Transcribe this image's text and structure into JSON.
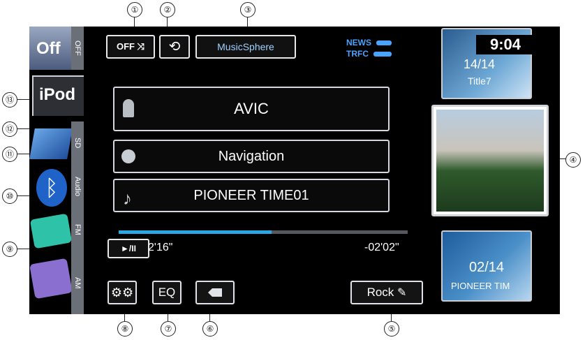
{
  "callouts": [
    "①",
    "②",
    "③",
    "④",
    "⑤",
    "⑥",
    "⑦",
    "⑧",
    "⑨",
    "⑩",
    "⑪",
    "⑫",
    "⑬"
  ],
  "sources": [
    {
      "label": "OFF",
      "button": "Off"
    },
    {
      "label": "iPod",
      "button": "iPod"
    },
    {
      "label": "SD",
      "button": ""
    },
    {
      "label": "Audio",
      "button": ""
    },
    {
      "label": "FM",
      "button": ""
    },
    {
      "label": "AM",
      "button": ""
    }
  ],
  "top_bar": {
    "shuffle": "OFF ⤨",
    "repeat": "⟲",
    "musicsphere_logo": "MusicSphere",
    "news": "NEWS",
    "trfc": "TRFC"
  },
  "clock": "9:04",
  "next_track": {
    "index": "14/14",
    "title": "Title7"
  },
  "prev_track": {
    "index": "02/14",
    "title": "PIONEER TIM"
  },
  "info": {
    "artist": "AVIC",
    "album": "Navigation",
    "song": "PIONEER TIME01"
  },
  "progress": {
    "elapsed": "2'16\"",
    "remaining": "-02'02\"",
    "fraction": 0.53
  },
  "buttons": {
    "play_pause": "►/II",
    "eq": "EQ",
    "genre": "Rock"
  },
  "colors": {
    "progress": "#2aa8e6",
    "accent": "#4a8fc8"
  }
}
